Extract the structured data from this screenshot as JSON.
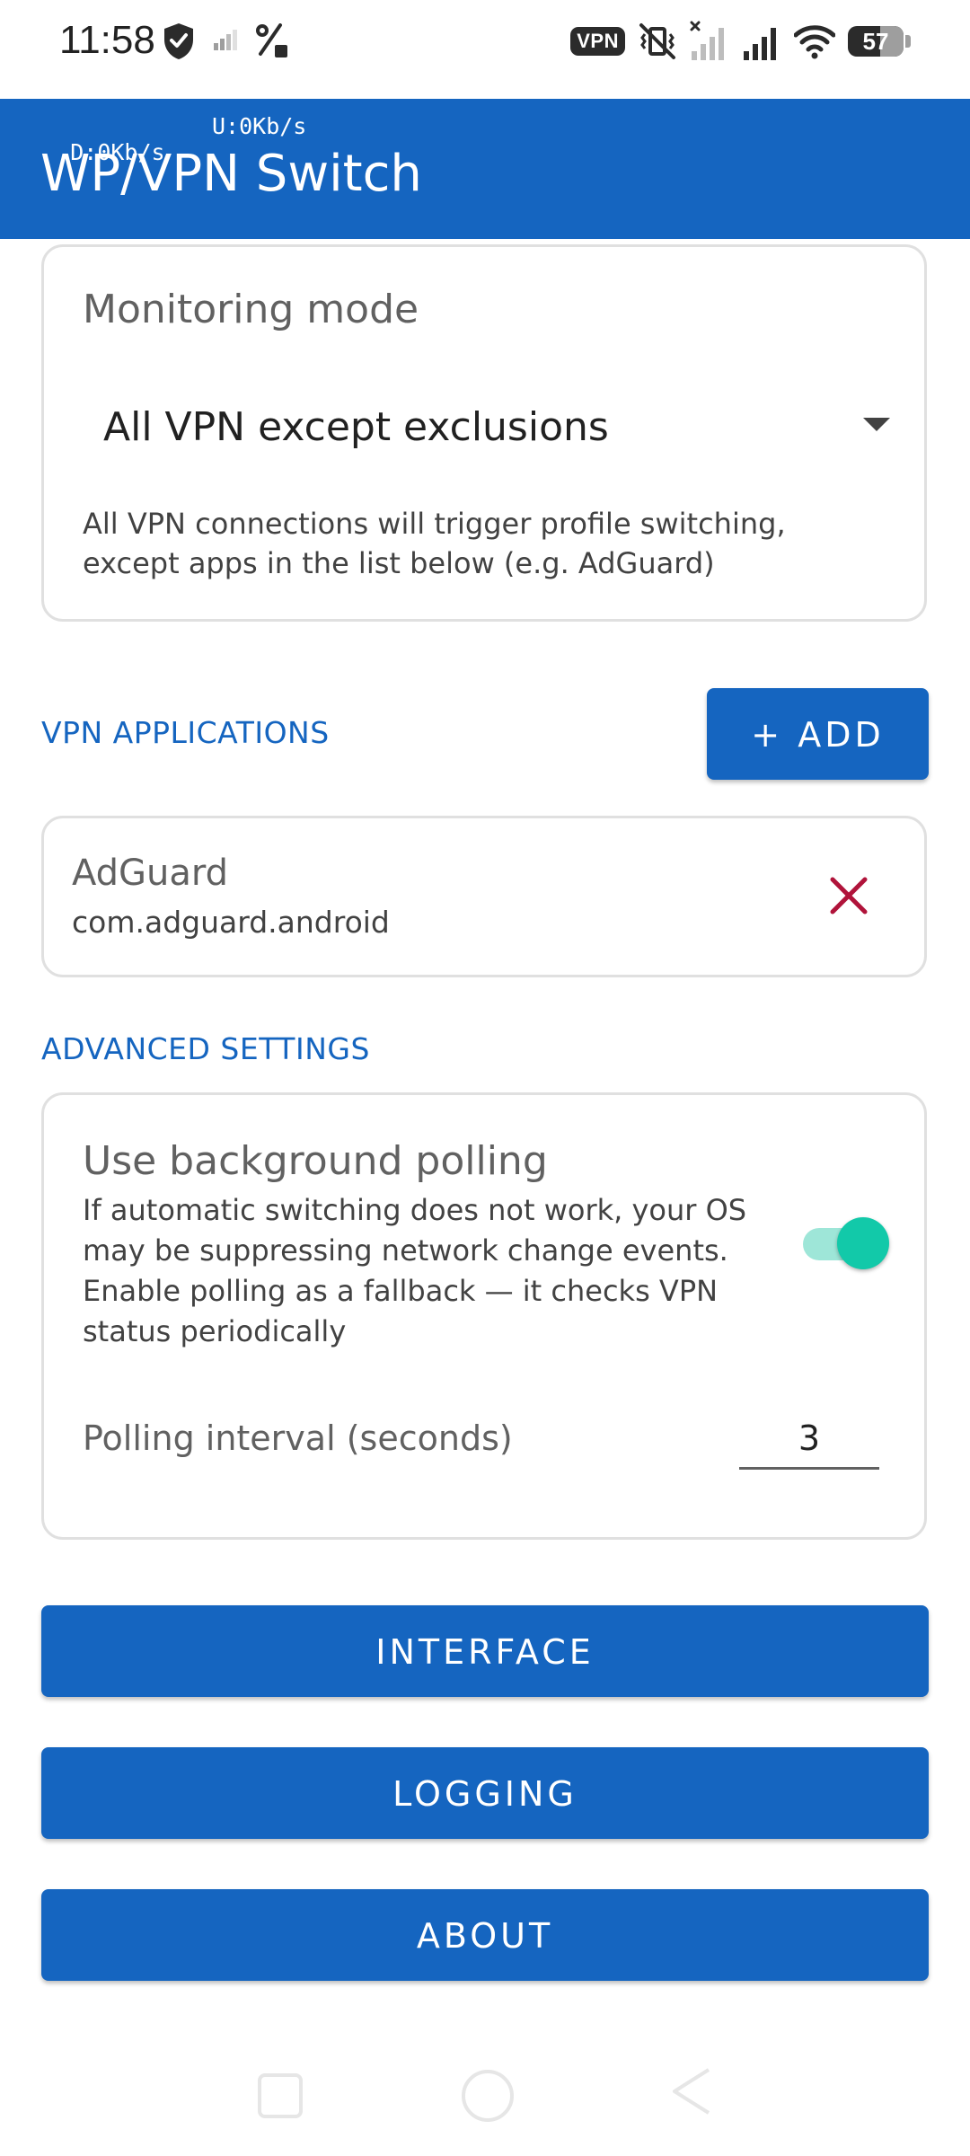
{
  "status_bar": {
    "time": "11:58",
    "vpn_badge": "VPN",
    "battery": "57"
  },
  "app_bar": {
    "download_speed": "D:0Kb/s",
    "upload_speed": "U:0Kb/s",
    "title": "WP/VPN Switch"
  },
  "monitoring": {
    "label": "Monitoring mode",
    "selected": "All VPN except exclusions",
    "description": "All VPN connections will trigger profile switching, except apps in the list below (e.g. AdGuard)"
  },
  "vpn_apps": {
    "title": "VPN APPLICATIONS",
    "add_label": "+ ADD",
    "items": [
      {
        "name": "AdGuard",
        "package": "com.adguard.android"
      }
    ]
  },
  "advanced": {
    "title": "ADVANCED SETTINGS",
    "polling_title": "Use background polling",
    "polling_description": "If automatic switching does not work, your OS may be suppressing network change events. Enable polling as a fallback — it checks VPN status periodically",
    "polling_enabled": true,
    "interval_label": "Polling interval (seconds)",
    "interval_value": "3"
  },
  "nav_buttons": {
    "interface": "INTERFACE",
    "logging": "LOGGING",
    "about": "ABOUT"
  },
  "colors": {
    "primary": "#1565c0",
    "toggle_on": "#12c9a9",
    "remove": "#b0133a"
  },
  "icons": [
    "shield-icon",
    "signal-icon",
    "percent-icon",
    "vibrate-off-icon",
    "no-sim-signal-icon",
    "signal-icon",
    "wifi-icon",
    "battery-icon",
    "remove-icon"
  ]
}
